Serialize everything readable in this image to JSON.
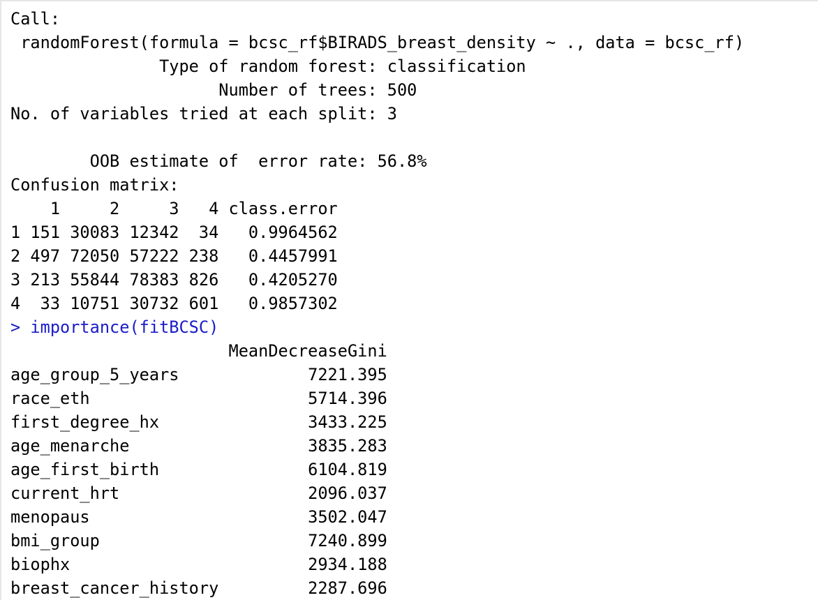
{
  "console": {
    "text_color": "#000000",
    "command_color": "#1b1bc8",
    "background": "#ffffff",
    "lines": [
      "Call:",
      " randomForest(formula = bcsc_rf$BIRADS_breast_density ~ ., data = bcsc_rf) ",
      "               Type of random forest: classification",
      "                     Number of trees: 500",
      "No. of variables tried at each split: 3",
      "",
      "        OOB estimate of  error rate: 56.8%",
      "Confusion matrix:",
      "    1     2     3   4 class.error",
      "1 151 30083 12342  34   0.9964562",
      "2 497 72050 57222 238   0.4457991",
      "3 213 55844 78383 826   0.4205270",
      "4  33 10751 30732 601   0.9857302",
      "> importance(fitBCSC)",
      "                      MeanDecreaseGini",
      "age_group_5_years             7221.395",
      "race_eth                      5714.396",
      "first_degree_hx               3433.225",
      "age_menarche                  3835.283",
      "age_first_birth               6104.819",
      "current_hrt                   2096.037",
      "menopaus                      3502.047",
      "bmi_group                     7240.899",
      "biophx                        2934.188",
      "breast_cancer_history         2287.696"
    ]
  }
}
